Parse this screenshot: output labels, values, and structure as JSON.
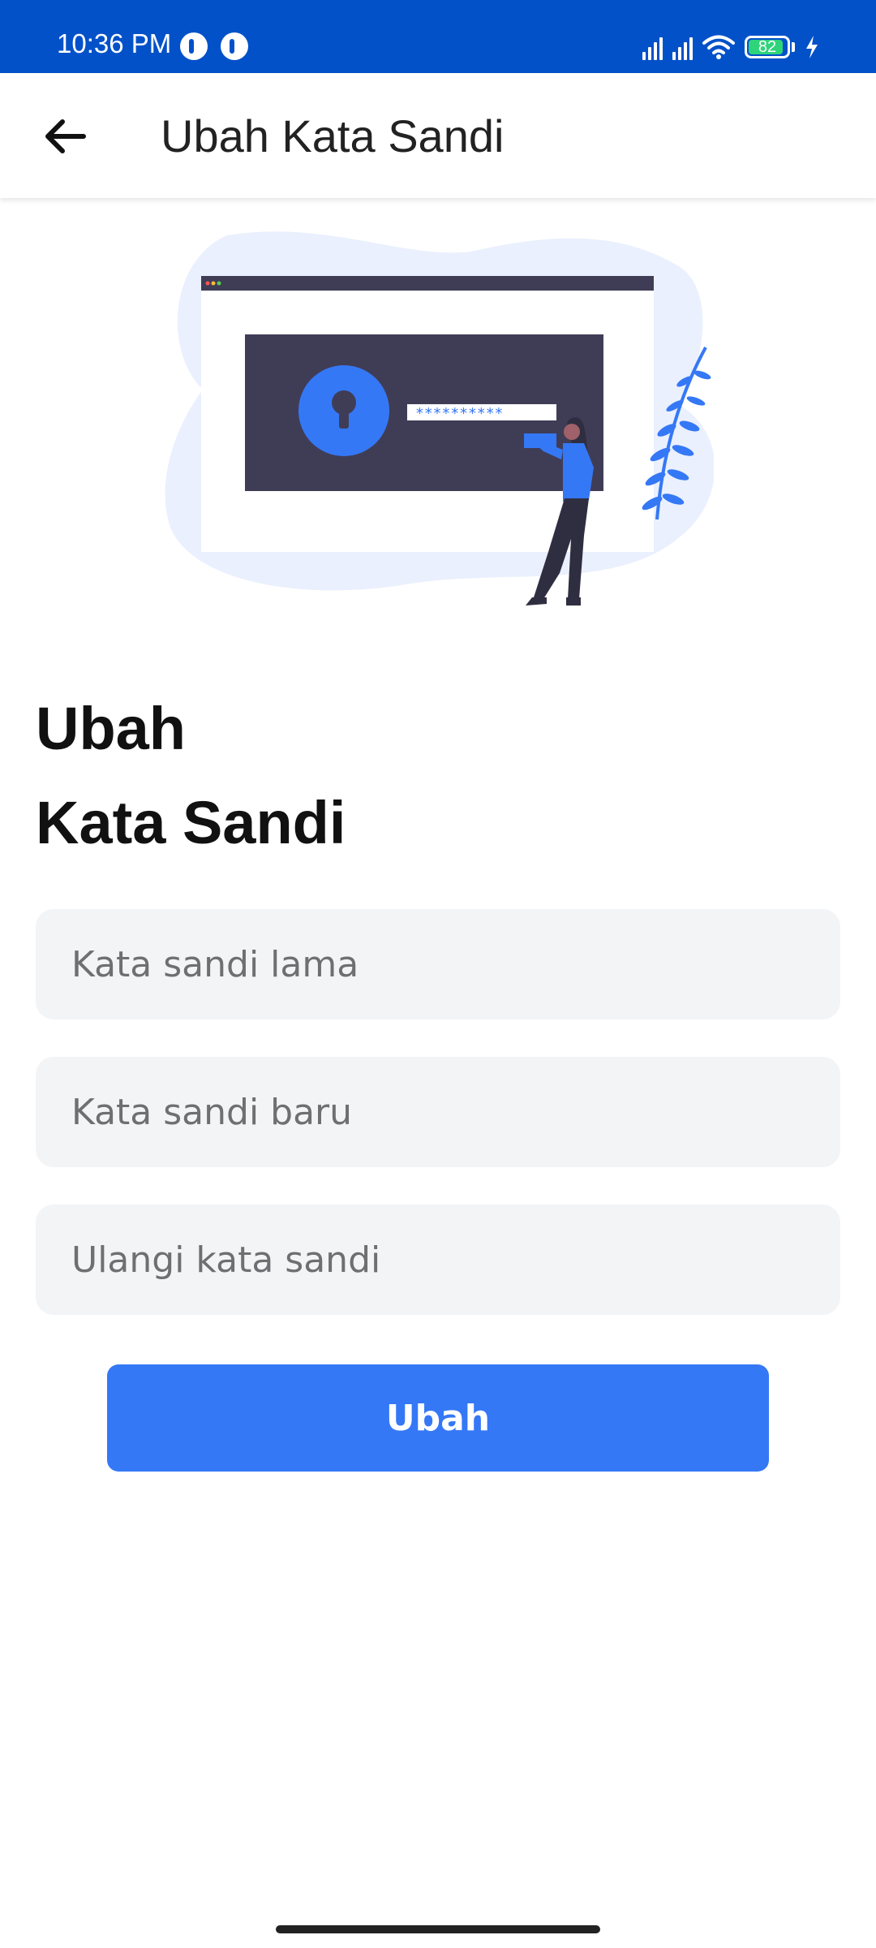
{
  "status_bar": {
    "time": "10:36 PM",
    "battery_level": "82",
    "icons": [
      "app-icon",
      "app-icon",
      "signal-icon",
      "signal-icon",
      "wifi-icon",
      "battery-icon",
      "charging-icon"
    ]
  },
  "app_bar": {
    "title": "Ubah Kata Sandi",
    "back_icon": "arrow-left-icon"
  },
  "illustration": {
    "password_mask": "**********"
  },
  "heading": {
    "line1": "Ubah",
    "line2": "Kata Sandi"
  },
  "form": {
    "old_password_placeholder": "Kata sandi lama",
    "new_password_placeholder": "Kata sandi baru",
    "confirm_password_placeholder": "Ulangi kata sandi",
    "submit_label": "Ubah"
  },
  "colors": {
    "status_bar": "#0251c9",
    "accent": "#3578f6",
    "field_bg": "#f3f4f6"
  }
}
